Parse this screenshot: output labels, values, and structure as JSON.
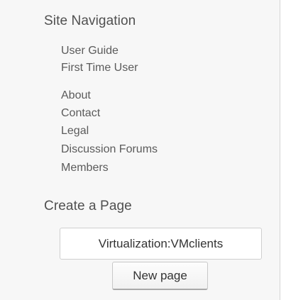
{
  "site_navigation": {
    "title": "Site Navigation",
    "group1": [
      {
        "label": "User Guide"
      },
      {
        "label": "First Time User"
      }
    ],
    "group2": [
      {
        "label": "About"
      },
      {
        "label": "Contact"
      },
      {
        "label": "Legal"
      },
      {
        "label": "Discussion Forums"
      },
      {
        "label": "Members"
      }
    ]
  },
  "create_page": {
    "title": "Create a Page",
    "input_value": "Virtualization:VMclients",
    "button_label": "New page"
  }
}
